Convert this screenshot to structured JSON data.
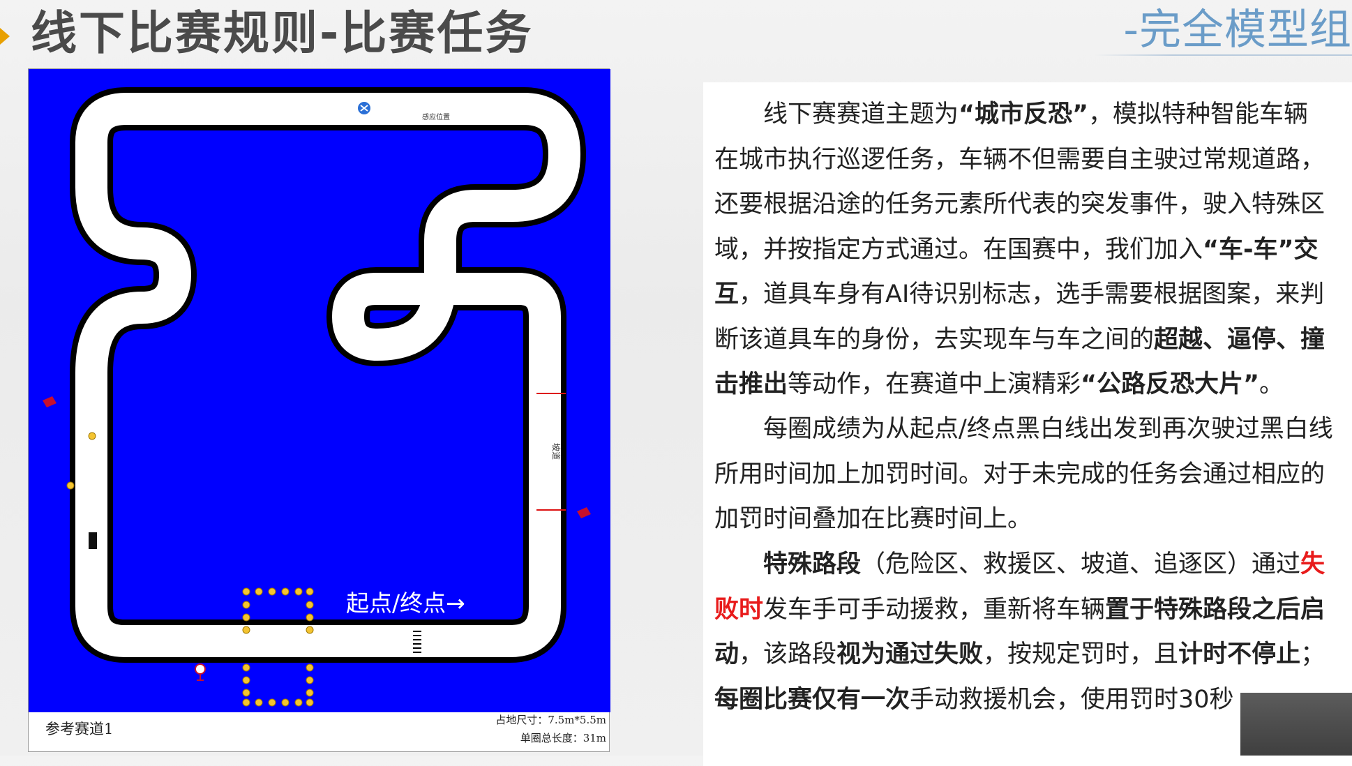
{
  "header": {
    "title": "线下比赛规则-比赛任务",
    "subtitle": "-完全模型组",
    "accent_color": "#e8a000",
    "subtitle_color": "#6a9cc8"
  },
  "track_map": {
    "start_finish_label": "起点/终点→",
    "sensor_label": "感应位置",
    "ramp_label": "坡道",
    "caption": "参考赛道1",
    "size_label": "占地尺寸：7.5m*5.5m",
    "length_label": "单圈总长度：31m",
    "colors": {
      "field": "#0000ff",
      "track": "#ffffff",
      "border": "#000000",
      "marker": "#f4c430",
      "obstacle": "#c8102e"
    },
    "icons": [
      "sensor-icon",
      "cone-icon",
      "pedestrian-icon"
    ]
  },
  "rules": {
    "p1": {
      "l1a": "线下赛赛道主题为",
      "l1b": "“城市反恐”",
      "l1c": "，模拟特种智能车辆",
      "l2": "在城市执行巡逻任务，车辆不但需要自主驶过常规道路，",
      "l3": "还要根据沿途的任务元素所代表的突发事件，驶入特殊区",
      "l4a": "域，并按指定方式通过。在国赛中，我们加入",
      "l4b": "“车-车”交",
      "l5a": "互",
      "l5b": "，道具车身有AI待识别标志，选手需要根据图案，来判",
      "l6a": "断该道具车的身份，去实现车与车之间的",
      "l6b": "超越、逼停、撞",
      "l7a": "击推出",
      "l7b": "等动作，在赛道中上演精彩",
      "l7c": "“公路反恐大片”",
      "l7d": "。"
    },
    "p2": {
      "l1": "每圈成绩为从起点/终点黑白线出发到再次驶过黑白线",
      "l2": "所用时间加上加罚时间。对于未完成的任务会通过相应的",
      "l3": "加罚时间叠加在比赛时间上。"
    },
    "p3": {
      "l1a": "特殊路段",
      "l1b": "（危险区、救援区、坡道、追逐区）通过",
      "l1c": "失",
      "l2a": "败时",
      "l2b": "发车手可手动援救，重新将车辆",
      "l2c": "置于特殊路段之后启",
      "l3a": "动",
      "l3b": "，该路段",
      "l3c": "视为通过失败",
      "l3d": "，按规定罚时，且",
      "l3e": "计时不停止",
      "l3f": "；",
      "l4a": "每圈比赛仅有一次",
      "l4b": "手动救援机会，使用罚时30秒"
    }
  }
}
